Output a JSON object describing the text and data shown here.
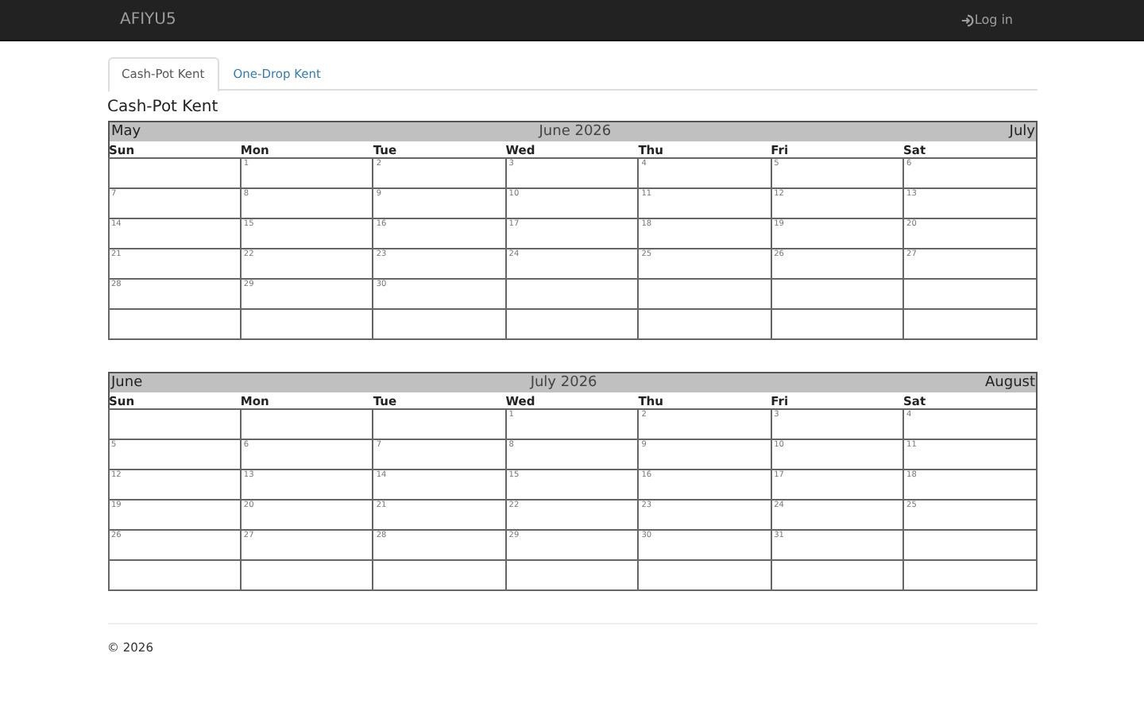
{
  "navbar": {
    "brand": "AFIYU5",
    "login": "Log in"
  },
  "tabs": [
    {
      "label": "Cash-Pot Kent",
      "selected": true
    },
    {
      "label": "One-Drop Kent",
      "selected": false
    }
  ],
  "heading": "Cash-Pot Kent",
  "calendars": [
    {
      "prev": "May",
      "title": "June 2026",
      "next": "July",
      "weekdays": [
        "Sun",
        "Mon",
        "Tue",
        "Wed",
        "Thu",
        "Fri",
        "Sat"
      ],
      "weeks": [
        [
          {
            "kind": "blank"
          },
          {
            "kind": "day",
            "day": "1"
          },
          {
            "kind": "day",
            "day": "2"
          },
          {
            "kind": "day",
            "day": "3"
          },
          {
            "kind": "day",
            "day": "4"
          },
          {
            "kind": "day",
            "day": "5"
          },
          {
            "kind": "day",
            "day": "6"
          }
        ],
        [
          {
            "kind": "day",
            "day": "7"
          },
          {
            "kind": "day",
            "day": "8"
          },
          {
            "kind": "day",
            "day": "9"
          },
          {
            "kind": "day",
            "day": "10"
          },
          {
            "kind": "day",
            "day": "11"
          },
          {
            "kind": "day",
            "day": "12"
          },
          {
            "kind": "day",
            "day": "13"
          }
        ],
        [
          {
            "kind": "day",
            "day": "14"
          },
          {
            "kind": "day",
            "day": "15"
          },
          {
            "kind": "day",
            "day": "16"
          },
          {
            "kind": "day",
            "day": "17"
          },
          {
            "kind": "day",
            "day": "18"
          },
          {
            "kind": "day",
            "day": "19"
          },
          {
            "kind": "day",
            "day": "20"
          }
        ],
        [
          {
            "kind": "day",
            "day": "21"
          },
          {
            "kind": "day",
            "day": "22"
          },
          {
            "kind": "day",
            "day": "23"
          },
          {
            "kind": "day",
            "day": "24"
          },
          {
            "kind": "day",
            "day": "25"
          },
          {
            "kind": "day",
            "day": "26"
          },
          {
            "kind": "day",
            "day": "27"
          }
        ],
        [
          {
            "kind": "day",
            "day": "28"
          },
          {
            "kind": "day",
            "day": "29"
          },
          {
            "kind": "day",
            "day": "30"
          },
          {
            "kind": "blank"
          },
          {
            "kind": "blank"
          },
          {
            "kind": "blank"
          },
          {
            "kind": "blank"
          }
        ],
        [
          {
            "kind": "blank"
          },
          {
            "kind": "blank"
          },
          {
            "kind": "blank"
          },
          {
            "kind": "blank"
          },
          {
            "kind": "blank"
          },
          {
            "kind": "blank"
          },
          {
            "kind": "blank"
          }
        ]
      ]
    },
    {
      "prev": "June",
      "title": "July 2026",
      "next": "August",
      "weekdays": [
        "Sun",
        "Mon",
        "Tue",
        "Wed",
        "Thu",
        "Fri",
        "Sat"
      ],
      "weeks": [
        [
          {
            "kind": "blank"
          },
          {
            "kind": "blank"
          },
          {
            "kind": "blank"
          },
          {
            "kind": "day",
            "day": "1"
          },
          {
            "kind": "day",
            "day": "2"
          },
          {
            "kind": "day",
            "day": "3"
          },
          {
            "kind": "day",
            "day": "4"
          }
        ],
        [
          {
            "kind": "day",
            "day": "5"
          },
          {
            "kind": "day",
            "day": "6"
          },
          {
            "kind": "day",
            "day": "7"
          },
          {
            "kind": "day",
            "day": "8"
          },
          {
            "kind": "day",
            "day": "9"
          },
          {
            "kind": "day",
            "day": "10"
          },
          {
            "kind": "day",
            "day": "11"
          }
        ],
        [
          {
            "kind": "day",
            "day": "12"
          },
          {
            "kind": "day",
            "day": "13"
          },
          {
            "kind": "day",
            "day": "14"
          },
          {
            "kind": "day",
            "day": "15"
          },
          {
            "kind": "day",
            "day": "16"
          },
          {
            "kind": "day",
            "day": "17"
          },
          {
            "kind": "day",
            "day": "18"
          }
        ],
        [
          {
            "kind": "day",
            "day": "19"
          },
          {
            "kind": "day",
            "day": "20"
          },
          {
            "kind": "day",
            "day": "21"
          },
          {
            "kind": "day",
            "day": "22"
          },
          {
            "kind": "day",
            "day": "23"
          },
          {
            "kind": "day",
            "day": "24"
          },
          {
            "kind": "day",
            "day": "25"
          }
        ],
        [
          {
            "kind": "day",
            "day": "26"
          },
          {
            "kind": "day",
            "day": "27"
          },
          {
            "kind": "day",
            "day": "28"
          },
          {
            "kind": "day",
            "day": "29"
          },
          {
            "kind": "day",
            "day": "30"
          },
          {
            "kind": "day",
            "day": "31"
          },
          {
            "kind": "blank"
          }
        ],
        [
          {
            "kind": "blank"
          },
          {
            "kind": "blank"
          },
          {
            "kind": "blank"
          },
          {
            "kind": "blank"
          },
          {
            "kind": "blank"
          },
          {
            "kind": "blank"
          },
          {
            "kind": "blank"
          }
        ]
      ]
    }
  ],
  "footer": "© 2026"
}
